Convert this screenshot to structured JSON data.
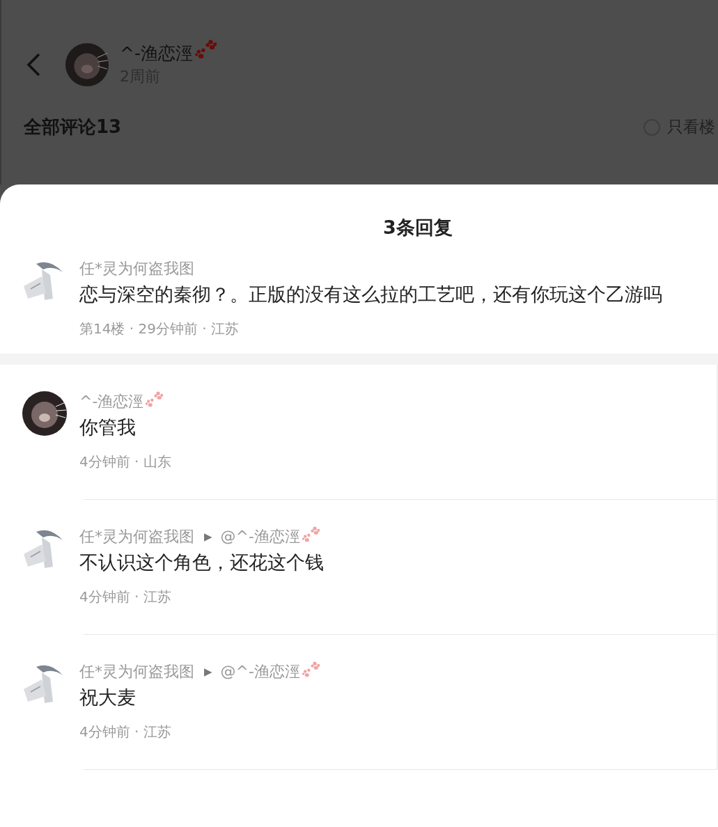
{
  "post_header": {
    "author": {
      "name": "^-渔恋涇",
      "badge": true
    },
    "time": "2周前"
  },
  "comments_bar": {
    "title": "全部评论13",
    "filter": {
      "label": "只看楼",
      "checked": false
    }
  },
  "reply_sheet": {
    "title": "3条回复",
    "main_comment": {
      "author": {
        "name": "任*灵为何盗我图",
        "badge": false
      },
      "text": "恋与深空的秦彻？。正版的没有这么拉的工艺吧，还有你玩这个乙游吗",
      "meta": "第14楼 · 29分钟前 · 江苏"
    },
    "replies": [
      {
        "author": {
          "name": "^-渔恋涇",
          "badge": true
        },
        "text": "你管我",
        "meta": "4分钟前 · 山东"
      },
      {
        "author": {
          "name": "任*灵为何盗我图",
          "badge": false
        },
        "arrow": "▶",
        "reply_to": {
          "name": "@^-渔恋涇",
          "badge": true
        },
        "text": "不认识这个角色，还花这个钱",
        "meta": "4分钟前 · 江苏"
      },
      {
        "author": {
          "name": "任*灵为何盗我图",
          "badge": false
        },
        "arrow": "▶",
        "reply_to": {
          "name": "@^-渔恋涇",
          "badge": true
        },
        "text": "祝大麦",
        "meta": "4分钟前 · 江苏"
      }
    ]
  }
}
